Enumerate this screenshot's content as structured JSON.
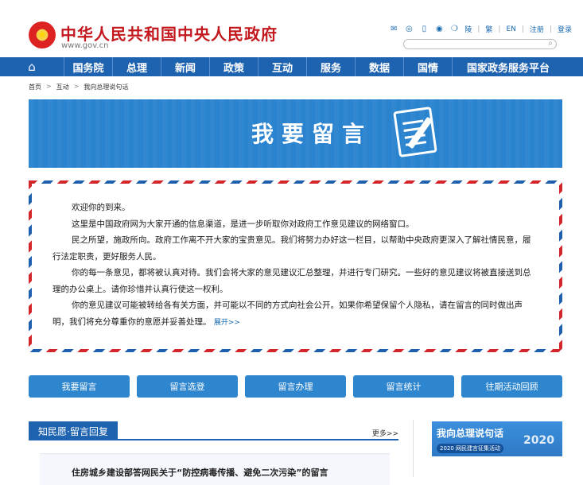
{
  "header": {
    "title": "中华人民共和国中央人民政府",
    "url": "www.gov.cn",
    "util_links": [
      "陵",
      "繁",
      "EN",
      "注册",
      "登录"
    ]
  },
  "nav": {
    "items": [
      "国务院",
      "总理",
      "新闻",
      "政策",
      "互动",
      "服务",
      "数据",
      "国情",
      "国家政务服务平台"
    ]
  },
  "breadcrumb": [
    "首页",
    "互动",
    "我向总理说句话"
  ],
  "banner": {
    "title": "我要留言"
  },
  "letter": {
    "paragraphs": [
      "欢迎你的到来。",
      "这里是中国政府网为大家开通的信息渠道，是进一步听取你对政府工作意见建议的网络窗口。",
      "民之所望，施政所向。政府工作离不开大家的宝贵意见。我们将努力办好这一栏目，以帮助中央政府更深入了解社情民意，履行法定职责，更好服务人民。",
      "你的每一条意见，都将被认真对待。我们会将大家的意见建议汇总整理，并进行专门研究。一些好的意见建议将被直接送到总理的办公桌上。请你珍惜并认真行使这一权利。",
      "你的意见建议可能被转给各有关方面，并可能以不同的方式向社会公开。如果你希望保留个人隐私，请在留言的同时做出声明，我们将充分尊重你的意愿并妥善处理。"
    ],
    "expand": "展开>>"
  },
  "tabs": [
    "我要留言",
    "留言选登",
    "留言办理",
    "留言统计",
    "往期活动回顾"
  ],
  "section": {
    "label": "知民愿·留言回复",
    "more": "更多>>",
    "first_item": "住房城乡建设部答网民关于“防控病毒传播、避免二次污染”的留言"
  },
  "promo": {
    "title": "我向总理说句话",
    "subtitle": "2020 网民建言征集活动",
    "year": "2020"
  }
}
